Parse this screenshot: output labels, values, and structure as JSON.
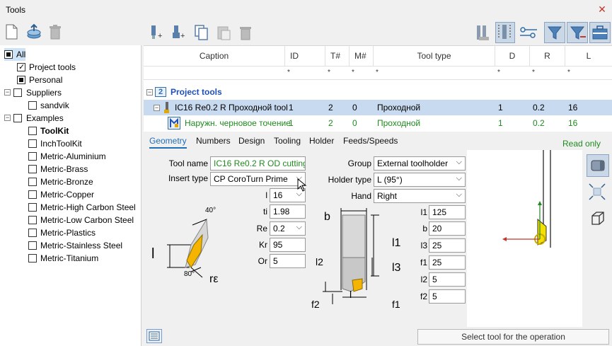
{
  "window": {
    "title": "Tools",
    "close_icon": "close-icon"
  },
  "left_toolbar": [
    "new-file-icon",
    "import-db-icon",
    "delete-icon"
  ],
  "tree": [
    {
      "label": "All",
      "state": "full",
      "bold": false
    },
    {
      "label": "Project tools",
      "state": "check"
    },
    {
      "label": "Personal",
      "state": "full"
    },
    {
      "label": "Suppliers",
      "state": "empty"
    },
    {
      "label": "sandvik",
      "state": "empty"
    },
    {
      "label": "Examples",
      "state": "empty"
    },
    {
      "label": "ToolKit",
      "state": "empty",
      "bold": true
    },
    {
      "label": "InchToolKit",
      "state": "empty"
    },
    {
      "label": "Metric-Aluminium",
      "state": "empty"
    },
    {
      "label": "Metric-Brass",
      "state": "empty"
    },
    {
      "label": "Metric-Bronze",
      "state": "empty"
    },
    {
      "label": "Metric-Copper",
      "state": "empty"
    },
    {
      "label": "Metric-High Carbon Steel",
      "state": "empty"
    },
    {
      "label": "Metric-Low Carbon Steel",
      "state": "empty"
    },
    {
      "label": "Metric-Plastics",
      "state": "empty"
    },
    {
      "label": "Metric-Stainless Steel",
      "state": "empty"
    },
    {
      "label": "Metric-Titanium",
      "state": "empty"
    }
  ],
  "grid": {
    "columns": [
      "Caption",
      "ID",
      "T#",
      "M#",
      "Tool type",
      "D",
      "R",
      "L"
    ],
    "filter": "*",
    "group": {
      "number": "2",
      "label": "Project tools"
    },
    "rows": [
      {
        "caption": "IC16 Re0.2 R Проходной tool",
        "id": "1",
        "t": "2",
        "m": "0",
        "type": "Проходной",
        "d": "1",
        "r": "0.2",
        "l": "16",
        "selected": true
      },
      {
        "caption": "Наружн. черновое точение",
        "id": "1",
        "t": "2",
        "m": "0",
        "type": "Проходной",
        "d": "1",
        "r": "0.2",
        "l": "16",
        "selected": false
      }
    ]
  },
  "tabs": [
    "Geometry",
    "Numbers",
    "Design",
    "Tooling",
    "Holder",
    "Feeds/Speeds"
  ],
  "read_only": "Read only",
  "form": {
    "tool_name_label": "Tool name",
    "tool_name_value": "IC16 Re0.2 R OD cutting",
    "insert_type_label": "Insert type",
    "insert_type_value": "CP CoroTurn Prime",
    "l_label": "l",
    "l_value": "16",
    "ti_label": "ti",
    "ti_value": "1.98",
    "re_label": "Re",
    "re_value": "0.2",
    "kr_label": "Kr",
    "kr_value": "95",
    "or_label": "Or",
    "or_value": "5",
    "group_label": "Group",
    "group_value": "External toolholder",
    "holder_type_label": "Holder type",
    "holder_type_value": "L (95°)",
    "hand_label": "Hand",
    "hand_value": "Right",
    "l1_label": "l1",
    "l1_value": "125",
    "b_label": "b",
    "b_value": "20",
    "l3_label": "l3",
    "l3_value": "25",
    "f1_label": "f1",
    "f1_value": "25",
    "l2_label": "l2",
    "l2_value": "5",
    "f2_label": "f2",
    "f2_value": "5"
  },
  "insert_diagram": {
    "angle_top": "40°",
    "angle_bottom": "80°",
    "l": "l",
    "re": "rε"
  },
  "holder_diagram": {
    "b": "b",
    "l1": "l1",
    "l2": "l2",
    "l3": "l3",
    "f1": "f1",
    "f2": "f2",
    "l": "l"
  },
  "footer": {
    "status": "Select tool for the operation",
    "icon": "list-icon"
  },
  "colors": {
    "accent": "#1f6fb8",
    "green": "#1f8a1f",
    "selection": "#c7daf0"
  }
}
